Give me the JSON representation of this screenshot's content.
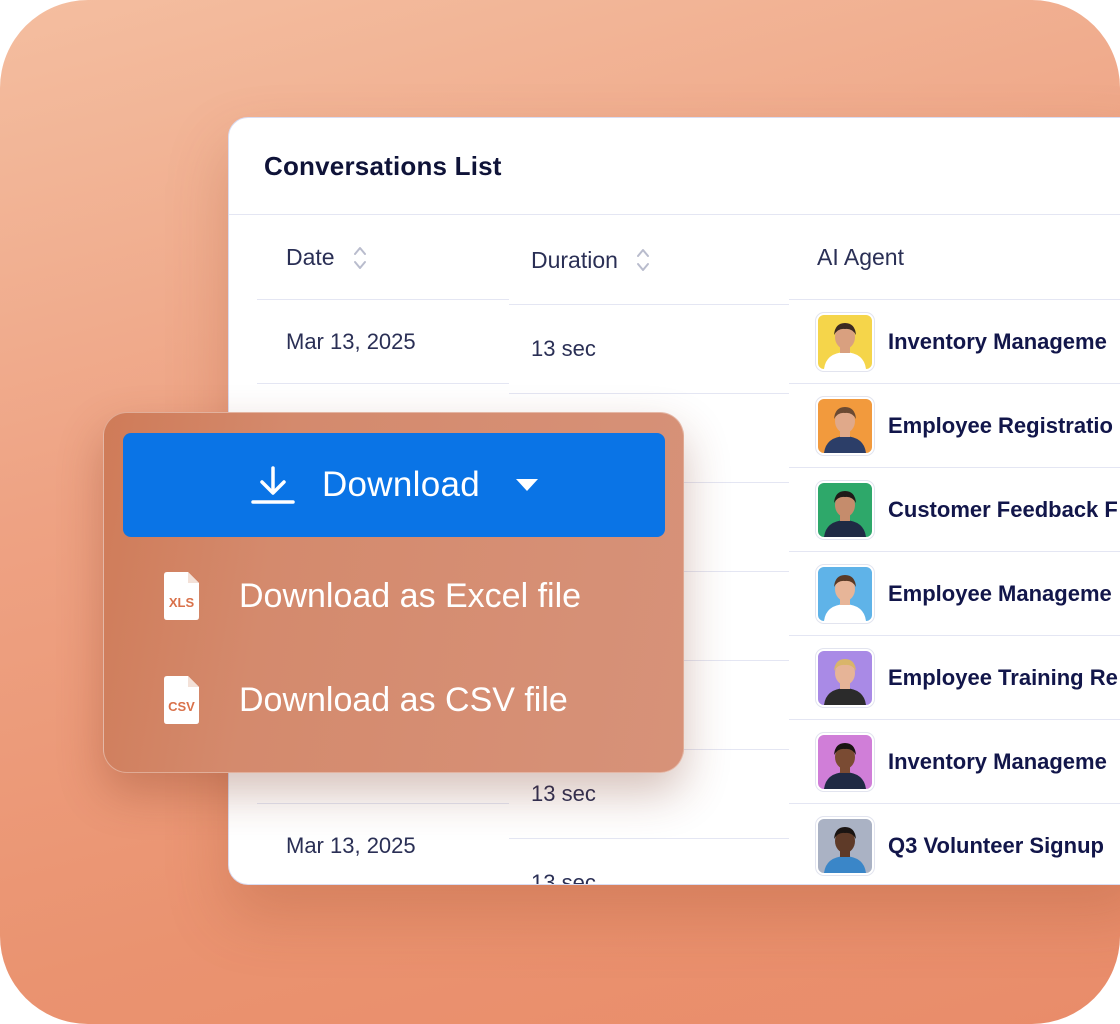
{
  "panel": {
    "title": "Conversations List"
  },
  "columns": {
    "date": "Date",
    "duration": "Duration",
    "agent": "AI Agent"
  },
  "dates": [
    "Mar 13, 2025",
    "",
    "",
    "",
    "",
    "",
    "Mar 13, 2025"
  ],
  "durations": [
    "13 sec",
    "",
    "",
    "",
    "",
    "13 sec",
    "13 sec"
  ],
  "agents": [
    {
      "name": "Inventory Manageme",
      "avatar_bg": "#f5d54a",
      "skin": "#d9a07f",
      "hair": "#3b2a22",
      "shirt": "#ffffff"
    },
    {
      "name": "Employee Registratio",
      "avatar_bg": "#f29a3d",
      "skin": "#e0a98a",
      "hair": "#6b4a32",
      "shirt": "#2c3e68"
    },
    {
      "name": "Customer Feedback F",
      "avatar_bg": "#2ea86a",
      "skin": "#c58c6c",
      "hair": "#1e1a18",
      "shirt": "#1f2a44"
    },
    {
      "name": "Employee Manageme",
      "avatar_bg": "#5fb3e8",
      "skin": "#e7b598",
      "hair": "#5a3a26",
      "shirt": "#ffffff"
    },
    {
      "name": "Employee Training Re",
      "avatar_bg": "#a98ae6",
      "skin": "#e6b497",
      "hair": "#d9b56a",
      "shirt": "#2b2b2b"
    },
    {
      "name": "Inventory Manageme",
      "avatar_bg": "#d07ed8",
      "skin": "#7a4b33",
      "hair": "#1a1412",
      "shirt": "#1f2a44"
    },
    {
      "name": "Q3 Volunteer Signup",
      "avatar_bg": "#aab2c4",
      "skin": "#5e3a28",
      "hair": "#1a1412",
      "shirt": "#3a86c8"
    }
  ],
  "dropdown": {
    "button_label": "Download",
    "items": [
      {
        "label": "Download as Excel file",
        "icon_text": "XLS"
      },
      {
        "label": "Download as CSV file",
        "icon_text": "CSV"
      }
    ]
  },
  "colors": {
    "accent": "#0a74e6",
    "file_icon_text": "#d9714a"
  }
}
